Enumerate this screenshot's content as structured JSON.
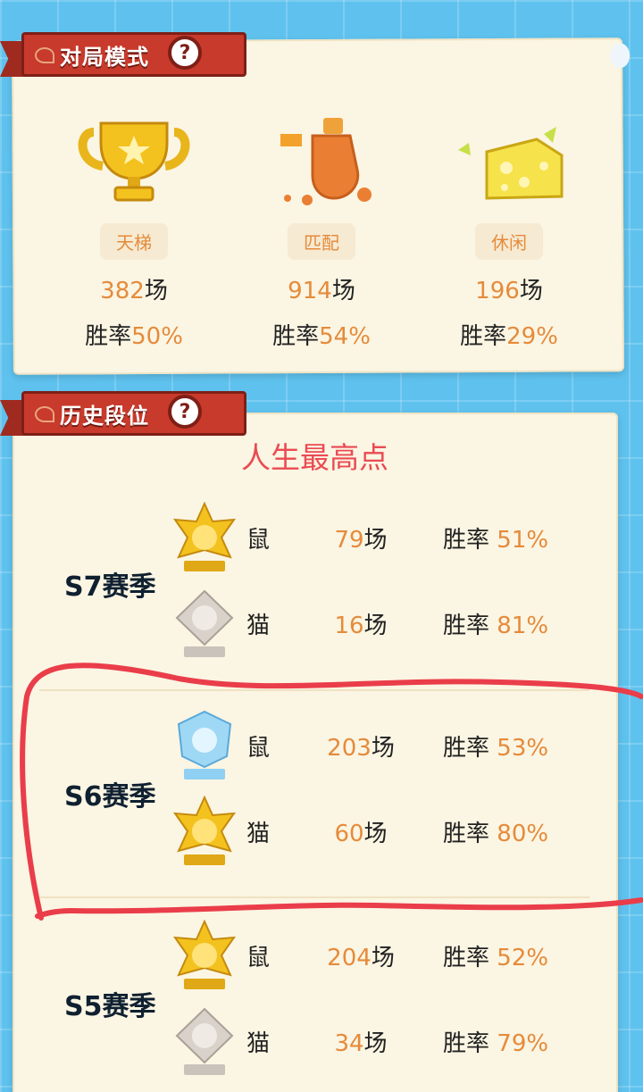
{
  "modes_section": {
    "title": "对局模式",
    "help_symbol": "?",
    "modes": [
      {
        "name": "天梯",
        "icon": "trophy-icon",
        "games": "382",
        "games_unit": "场",
        "rate_label": "胜率",
        "rate": "50%"
      },
      {
        "name": "匹配",
        "icon": "cheese-shaker-icon",
        "games": "914",
        "games_unit": "场",
        "rate_label": "胜率",
        "rate": "54%"
      },
      {
        "name": "休闲",
        "icon": "cheese-icon",
        "games": "196",
        "games_unit": "场",
        "rate_label": "胜率",
        "rate": "29%"
      }
    ]
  },
  "history_section": {
    "title": "历史段位",
    "help_symbol": "?",
    "annotation": "人生最高点",
    "seasons": [
      {
        "name": "S7赛季",
        "rows": [
          {
            "role": "鼠",
            "badge": "gold-rank-badge-icon",
            "games": "79",
            "unit": "场",
            "rate_label": "胜率",
            "rate": "51%"
          },
          {
            "role": "猫",
            "badge": "silver-rank-badge-icon",
            "games": "16",
            "unit": "场",
            "rate_label": "胜率",
            "rate": "81%"
          }
        ]
      },
      {
        "name": "S6赛季",
        "rows": [
          {
            "role": "鼠",
            "badge": "diamond-rank-badge-icon",
            "games": "203",
            "unit": "场",
            "rate_label": "胜率",
            "rate": "53%"
          },
          {
            "role": "猫",
            "badge": "gold-rank-badge-icon",
            "games": "60",
            "unit": "场",
            "rate_label": "胜率",
            "rate": "80%"
          }
        ]
      },
      {
        "name": "S5赛季",
        "rows": [
          {
            "role": "鼠",
            "badge": "gold-rank-badge-icon",
            "games": "204",
            "unit": "场",
            "rate_label": "胜率",
            "rate": "52%"
          },
          {
            "role": "猫",
            "badge": "silver-rank-badge-icon",
            "games": "34",
            "unit": "场",
            "rate_label": "胜率",
            "rate": "79%"
          }
        ]
      }
    ]
  },
  "colors": {
    "accent_orange": "#e58b3b",
    "ribbon_red": "#c83a2b",
    "annotation_red": "#ea4b52",
    "gold_badge": "#f2b21b",
    "silver_badge": "#c9c3bb",
    "diamond_badge": "#8fd0f3"
  }
}
